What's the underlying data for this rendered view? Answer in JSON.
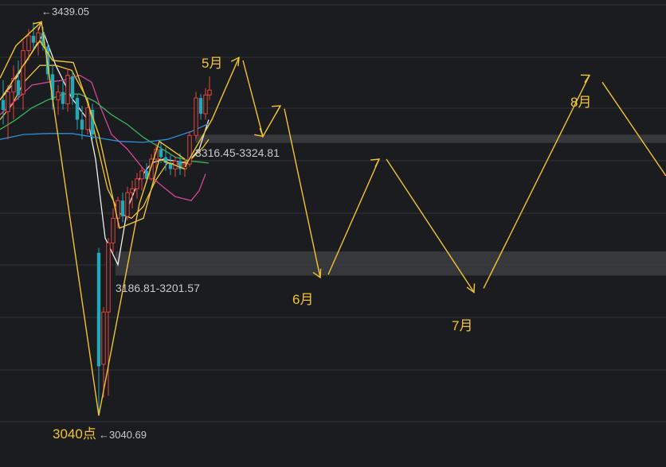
{
  "chart_data": {
    "type": "candlestick",
    "title": "",
    "xlabel": "",
    "ylabel": "",
    "ylim": [
      3025,
      3450
    ],
    "colors": {
      "background": "#1b1c20",
      "grid": "#33353b",
      "zone": "#3c3d41",
      "up": "#e5443c",
      "down": "#22a8b8",
      "forecast": "#f2c431",
      "label_gold": "#f2c431",
      "label_gray": "#c9c9c9",
      "ma_white": "#f0f0f0",
      "ma_yellow": "#f2c431",
      "ma_pink": "#d6449a",
      "ma_green": "#3db45a",
      "ma_blue": "#2f8fd6"
    },
    "price_labels": {
      "high": "←3439.05",
      "low": "←3040.69",
      "low_big": "3040点"
    },
    "zones": [
      {
        "label": "3316.45-3324.81",
        "low": 3316.45,
        "high": 3324.81
      },
      {
        "label": "3186.81-3201.57",
        "low": 3186.81,
        "high": 3201.57
      }
    ],
    "months": [
      {
        "label": "5月",
        "t": 295,
        "y": 3395
      },
      {
        "label": "6月",
        "t": 405,
        "y": 3180
      },
      {
        "label": "7月",
        "t": 597,
        "y": 3165
      },
      {
        "label": "8月",
        "t": 742,
        "y": 3385
      }
    ],
    "candles": [
      {
        "t": 4,
        "o": 3360,
        "h": 3380,
        "l": 3335,
        "c": 3350
      },
      {
        "t": 10,
        "o": 3348,
        "h": 3375,
        "l": 3320,
        "c": 3368
      },
      {
        "t": 17,
        "o": 3368,
        "h": 3395,
        "l": 3340,
        "c": 3382
      },
      {
        "t": 23,
        "o": 3380,
        "h": 3400,
        "l": 3360,
        "c": 3365
      },
      {
        "t": 29,
        "o": 3366,
        "h": 3420,
        "l": 3350,
        "c": 3410
      },
      {
        "t": 36,
        "o": 3410,
        "h": 3432,
        "l": 3400,
        "c": 3425
      },
      {
        "t": 42,
        "o": 3425,
        "h": 3439,
        "l": 3412,
        "c": 3418
      },
      {
        "t": 48,
        "o": 3418,
        "h": 3434,
        "l": 3405,
        "c": 3428
      },
      {
        "t": 54,
        "o": 3428,
        "h": 3434,
        "l": 3410,
        "c": 3415
      },
      {
        "t": 60,
        "o": 3414,
        "h": 3418,
        "l": 3380,
        "c": 3386
      },
      {
        "t": 66,
        "o": 3386,
        "h": 3395,
        "l": 3350,
        "c": 3360
      },
      {
        "t": 73,
        "o": 3360,
        "h": 3375,
        "l": 3345,
        "c": 3368
      },
      {
        "t": 79,
        "o": 3368,
        "h": 3380,
        "l": 3350,
        "c": 3356
      },
      {
        "t": 85,
        "o": 3356,
        "h": 3392,
        "l": 3348,
        "c": 3385
      },
      {
        "t": 91,
        "o": 3384,
        "h": 3388,
        "l": 3355,
        "c": 3362
      },
      {
        "t": 97,
        "o": 3362,
        "h": 3366,
        "l": 3330,
        "c": 3340
      },
      {
        "t": 103,
        "o": 3340,
        "h": 3354,
        "l": 3320,
        "c": 3330
      },
      {
        "t": 110,
        "o": 3330,
        "h": 3360,
        "l": 3325,
        "c": 3352
      },
      {
        "t": 116,
        "o": 3350,
        "h": 3356,
        "l": 3320,
        "c": 3325
      },
      {
        "t": 124,
        "o": 3205,
        "h": 3210,
        "l": 3040,
        "c": 3090
      },
      {
        "t": 130,
        "o": 3092,
        "h": 3150,
        "l": 3058,
        "c": 3145
      },
      {
        "t": 136,
        "o": 3145,
        "h": 3220,
        "l": 3060,
        "c": 3215
      },
      {
        "t": 142,
        "o": 3215,
        "h": 3250,
        "l": 3205,
        "c": 3240
      },
      {
        "t": 148,
        "o": 3240,
        "h": 3262,
        "l": 3230,
        "c": 3258
      },
      {
        "t": 154,
        "o": 3258,
        "h": 3266,
        "l": 3236,
        "c": 3242
      },
      {
        "t": 160,
        "o": 3242,
        "h": 3272,
        "l": 3238,
        "c": 3266
      },
      {
        "t": 166,
        "o": 3266,
        "h": 3278,
        "l": 3250,
        "c": 3270
      },
      {
        "t": 172,
        "o": 3270,
        "h": 3286,
        "l": 3260,
        "c": 3280
      },
      {
        "t": 178,
        "o": 3280,
        "h": 3292,
        "l": 3268,
        "c": 3288
      },
      {
        "t": 184,
        "o": 3288,
        "h": 3296,
        "l": 3276,
        "c": 3280
      },
      {
        "t": 190,
        "o": 3280,
        "h": 3305,
        "l": 3278,
        "c": 3300
      },
      {
        "t": 196,
        "o": 3300,
        "h": 3316,
        "l": 3290,
        "c": 3310
      },
      {
        "t": 202,
        "o": 3310,
        "h": 3318,
        "l": 3296,
        "c": 3302
      },
      {
        "t": 208,
        "o": 3302,
        "h": 3312,
        "l": 3288,
        "c": 3296
      },
      {
        "t": 214,
        "o": 3296,
        "h": 3304,
        "l": 3284,
        "c": 3290
      },
      {
        "t": 220,
        "o": 3290,
        "h": 3302,
        "l": 3282,
        "c": 3298
      },
      {
        "t": 226,
        "o": 3298,
        "h": 3306,
        "l": 3284,
        "c": 3290
      },
      {
        "t": 232,
        "o": 3290,
        "h": 3300,
        "l": 3282,
        "c": 3295
      },
      {
        "t": 238,
        "o": 3295,
        "h": 3328,
        "l": 3292,
        "c": 3324
      },
      {
        "t": 246,
        "o": 3324,
        "h": 3368,
        "l": 3320,
        "c": 3362
      },
      {
        "t": 252,
        "o": 3362,
        "h": 3366,
        "l": 3340,
        "c": 3346
      },
      {
        "t": 258,
        "o": 3346,
        "h": 3372,
        "l": 3340,
        "c": 3365
      },
      {
        "t": 263,
        "o": 3365,
        "h": 3384,
        "l": 3360,
        "c": 3370
      }
    ],
    "ma_lines": [
      {
        "color": "ma_white",
        "points": [
          [
            0,
            3360
          ],
          [
            15,
            3375
          ],
          [
            30,
            3395
          ],
          [
            45,
            3415
          ],
          [
            55,
            3428
          ],
          [
            70,
            3395
          ],
          [
            90,
            3362
          ],
          [
            110,
            3340
          ],
          [
            120,
            3300
          ],
          [
            132,
            3220
          ],
          [
            148,
            3193
          ],
          [
            160,
            3250
          ],
          [
            175,
            3280
          ],
          [
            190,
            3296
          ],
          [
            205,
            3300
          ],
          [
            220,
            3298
          ],
          [
            235,
            3296
          ],
          [
            250,
            3310
          ],
          [
            262,
            3340
          ]
        ]
      },
      {
        "color": "ma_yellow",
        "points": [
          [
            0,
            3340
          ],
          [
            15,
            3355
          ],
          [
            30,
            3378
          ],
          [
            50,
            3395
          ],
          [
            70,
            3395
          ],
          [
            90,
            3390
          ],
          [
            110,
            3360
          ],
          [
            122,
            3315
          ],
          [
            135,
            3270
          ],
          [
            150,
            3245
          ],
          [
            165,
            3240
          ],
          [
            180,
            3252
          ],
          [
            195,
            3278
          ],
          [
            210,
            3296
          ],
          [
            225,
            3295
          ],
          [
            240,
            3300
          ],
          [
            255,
            3312
          ],
          [
            262,
            3320
          ]
        ]
      },
      {
        "color": "ma_pink",
        "points": [
          [
            0,
            3345
          ],
          [
            20,
            3360
          ],
          [
            40,
            3375
          ],
          [
            60,
            3378
          ],
          [
            80,
            3380
          ],
          [
            100,
            3385
          ],
          [
            115,
            3378
          ],
          [
            125,
            3355
          ],
          [
            140,
            3325
          ],
          [
            160,
            3310
          ],
          [
            180,
            3290
          ],
          [
            200,
            3275
          ],
          [
            220,
            3262
          ],
          [
            240,
            3258
          ],
          [
            250,
            3268
          ],
          [
            258,
            3285
          ]
        ]
      },
      {
        "color": "ma_green",
        "points": [
          [
            0,
            3330
          ],
          [
            20,
            3340
          ],
          [
            40,
            3352
          ],
          [
            60,
            3360
          ],
          [
            80,
            3366
          ],
          [
            100,
            3366
          ],
          [
            120,
            3358
          ],
          [
            140,
            3345
          ],
          [
            160,
            3335
          ],
          [
            180,
            3322
          ],
          [
            200,
            3312
          ],
          [
            220,
            3302
          ],
          [
            240,
            3298
          ],
          [
            262,
            3296
          ]
        ]
      },
      {
        "color": "ma_blue",
        "points": [
          [
            0,
            3320
          ],
          [
            30,
            3325
          ],
          [
            60,
            3326
          ],
          [
            90,
            3326
          ],
          [
            120,
            3322
          ],
          [
            150,
            3318
          ],
          [
            180,
            3317
          ],
          [
            210,
            3320
          ],
          [
            240,
            3328
          ],
          [
            262,
            3336
          ]
        ]
      }
    ],
    "wave_lines": [
      {
        "points": [
          [
            0,
            3382
          ],
          [
            20,
            3415
          ],
          [
            52,
            3439
          ],
          [
            124,
            3040
          ],
          [
            175,
            3255
          ],
          [
            200,
            3318
          ],
          [
            232,
            3300
          ]
        ]
      },
      {
        "points": [
          [
            0,
            3360
          ],
          [
            50,
            3420
          ],
          [
            66,
            3400
          ],
          [
            92,
            3398
          ],
          [
            124,
            3325
          ],
          [
            150,
            3230
          ],
          [
            180,
            3240
          ],
          [
            200,
            3300
          ],
          [
            232,
            3290
          ]
        ]
      },
      {
        "points": [
          [
            232,
            3292
          ],
          [
            266,
            3340
          ],
          [
            300,
            3403
          ]
        ]
      },
      {
        "points": [
          [
            305,
            3400
          ],
          [
            330,
            3323
          ],
          [
            352,
            3354
          ]
        ]
      },
      {
        "points": [
          [
            357,
            3351
          ],
          [
            402,
            3180
          ]
        ]
      },
      {
        "points": [
          [
            412,
            3183
          ],
          [
            476,
            3300
          ]
        ]
      },
      {
        "points": [
          [
            485,
            3300
          ],
          [
            595,
            3165
          ]
        ]
      },
      {
        "points": [
          [
            607,
            3169
          ],
          [
            740,
            3385
          ]
        ]
      },
      {
        "points": [
          [
            756,
            3378
          ],
          [
            836,
            3283
          ]
        ]
      }
    ],
    "arrows": [
      [
        289,
        3390,
        300,
        3403
      ],
      [
        320,
        3330,
        330,
        3323
      ],
      [
        342,
        3349,
        352,
        3354
      ],
      [
        396,
        3190,
        402,
        3180
      ],
      [
        465,
        3294,
        476,
        3300
      ],
      [
        589,
        3175,
        595,
        3165
      ],
      [
        728,
        3380,
        740,
        3385
      ],
      [
        42,
        3432,
        52,
        3439
      ]
    ]
  }
}
